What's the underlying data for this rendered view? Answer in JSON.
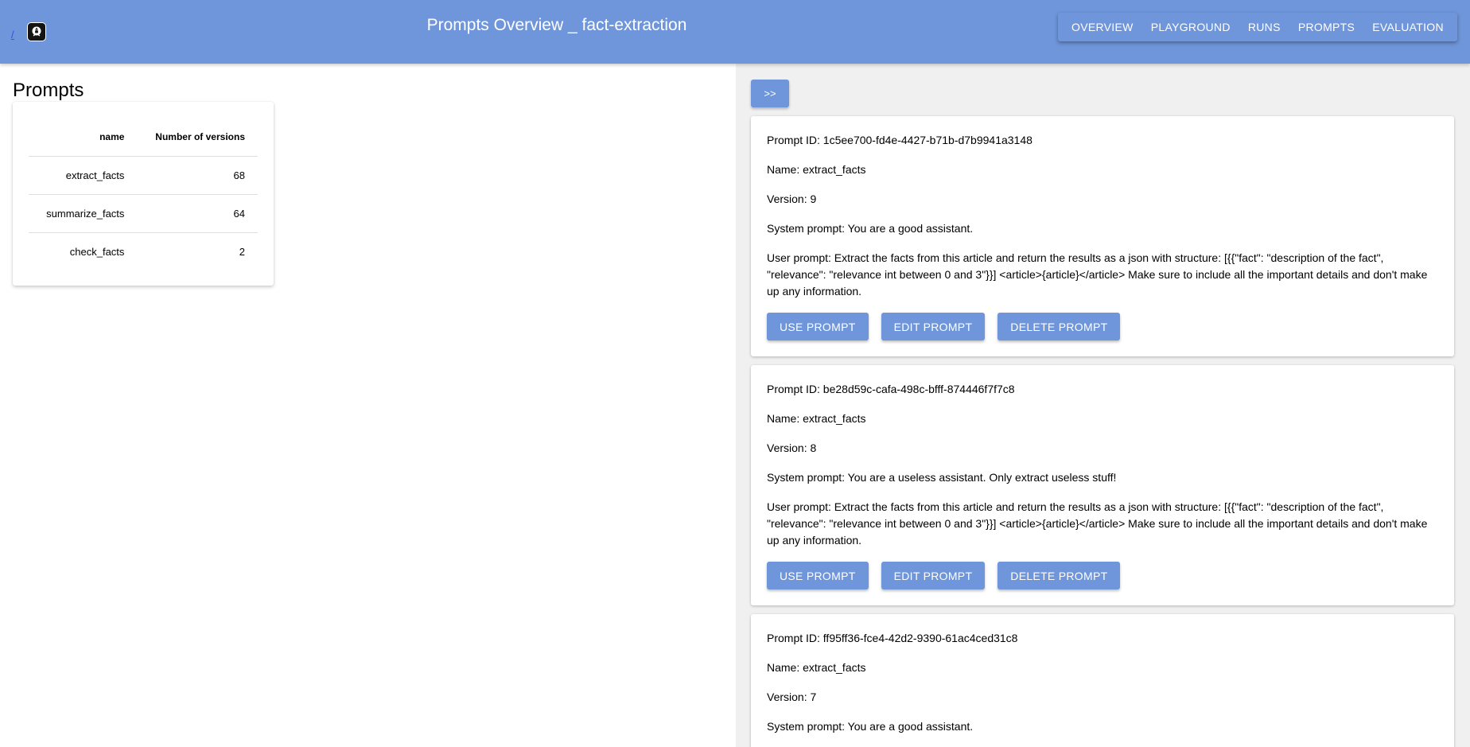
{
  "header": {
    "logo_link": "/",
    "title": "Prompts Overview _ fact-extraction",
    "nav": [
      "OVERVIEW",
      "PLAYGROUND",
      "RUNS",
      "PROMPTS",
      "EVALUATION"
    ]
  },
  "left": {
    "title": "Prompts",
    "table": {
      "headers": [
        "name",
        "Number of versions"
      ],
      "rows": [
        [
          "extract_facts",
          "68"
        ],
        [
          "summarize_facts",
          "64"
        ],
        [
          "check_facts",
          "2"
        ]
      ]
    }
  },
  "right": {
    "toggle_label": ">>",
    "buttons": {
      "use": "USE PROMPT",
      "edit": "EDIT PROMPT",
      "delete": "DELETE PROMPT"
    },
    "cards": [
      {
        "id": "Prompt ID: 1c5ee700-fd4e-4427-b71b-d7b9941a3148",
        "name": "Name: extract_facts",
        "version": "Version: 9",
        "system": "System prompt: You are a good assistant.",
        "user": "User prompt: Extract the facts from this article and return the results as a json with structure: [{{\"fact\": \"description of the fact\", \"relevance\": \"relevance int between 0 and 3\"}}] <article>{article}</article> Make sure to include all the important details and don't make up any information."
      },
      {
        "id": "Prompt ID: be28d59c-cafa-498c-bfff-874446f7f7c8",
        "name": "Name: extract_facts",
        "version": "Version: 8",
        "system": "System prompt: You are a useless assistant. Only extract useless stuff!",
        "user": "User prompt: Extract the facts from this article and return the results as a json with structure: [{{\"fact\": \"description of the fact\", \"relevance\": \"relevance int between 0 and 3\"}}] <article>{article}</article> Make sure to include all the important details and don't make up any information."
      },
      {
        "id": "Prompt ID: ff95ff36-fce4-42d2-9390-61ac4ced31c8",
        "name": "Name: extract_facts",
        "version": "Version: 7",
        "system": "System prompt: You are a good assistant.",
        "user": ""
      }
    ]
  }
}
